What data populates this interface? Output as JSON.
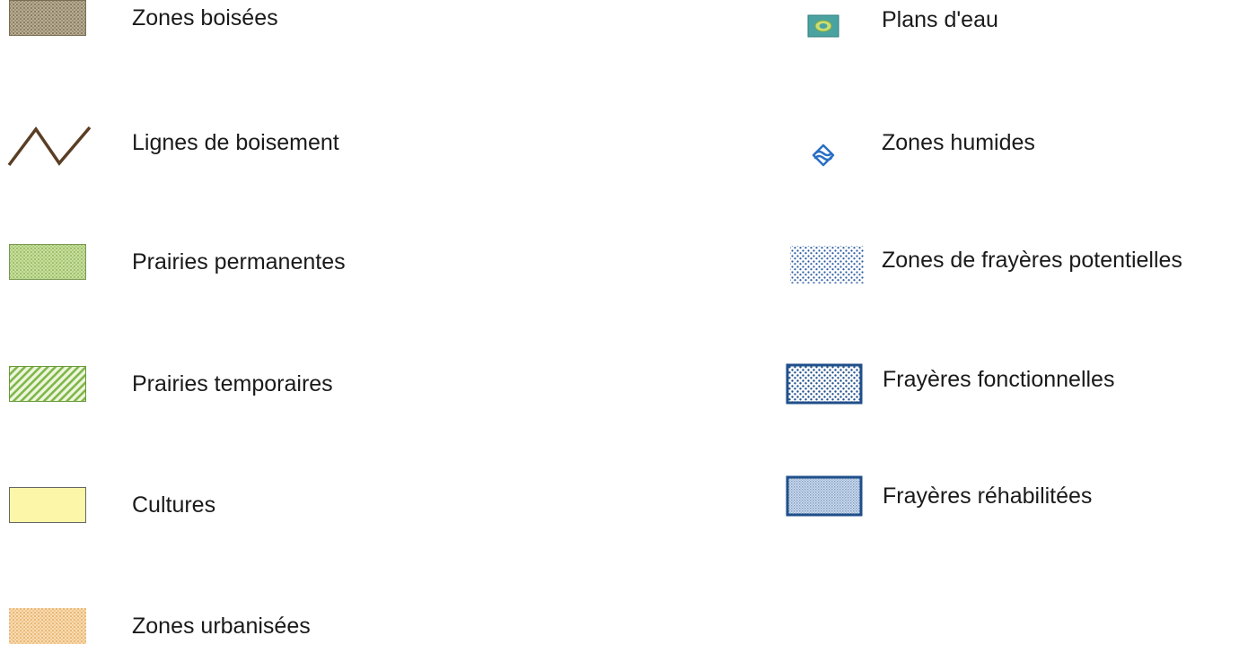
{
  "legend": {
    "left_items": [
      {
        "label": "Zones boisées",
        "symbol": "brown-green-stipple"
      },
      {
        "label": "Lignes de boisement",
        "symbol": "brown-zigzag-line"
      },
      {
        "label": "Prairies permanentes",
        "symbol": "light-green-stipple"
      },
      {
        "label": "Prairies temporaires",
        "symbol": "green-diagonal-hatch"
      },
      {
        "label": "Cultures",
        "symbol": "pale-yellow-fill"
      },
      {
        "label": "Zones urbanisées",
        "symbol": "peach-stipple"
      }
    ],
    "right_items": [
      {
        "label": "Plans d'eau",
        "symbol": "teal-pond"
      },
      {
        "label": "Zones humides",
        "symbol": "blue-wetland-glyph"
      },
      {
        "label": "Zones de frayères potentielles",
        "symbol": "blue-dot-stipple"
      },
      {
        "label": "Frayères fonctionnelles",
        "symbol": "blue-dot-stipple-bordered"
      },
      {
        "label": "Frayères réhabilitées",
        "symbol": "blue-fine-stipple-bordered"
      }
    ]
  },
  "colors": {
    "woodland": "#a59a7e",
    "hedgerow_line": "#5a3e25",
    "permanent_meadow": "#b9d48f",
    "temporary_meadow_hatch": "#8fbf5a",
    "crops": "#fbf6a8",
    "urban": "#f2c98e",
    "water_body": "#4aa3a0",
    "wetland": "#2a6fc4",
    "spawning_dots": "#2a5a9e",
    "spawning_border": "#1f4f8a"
  }
}
